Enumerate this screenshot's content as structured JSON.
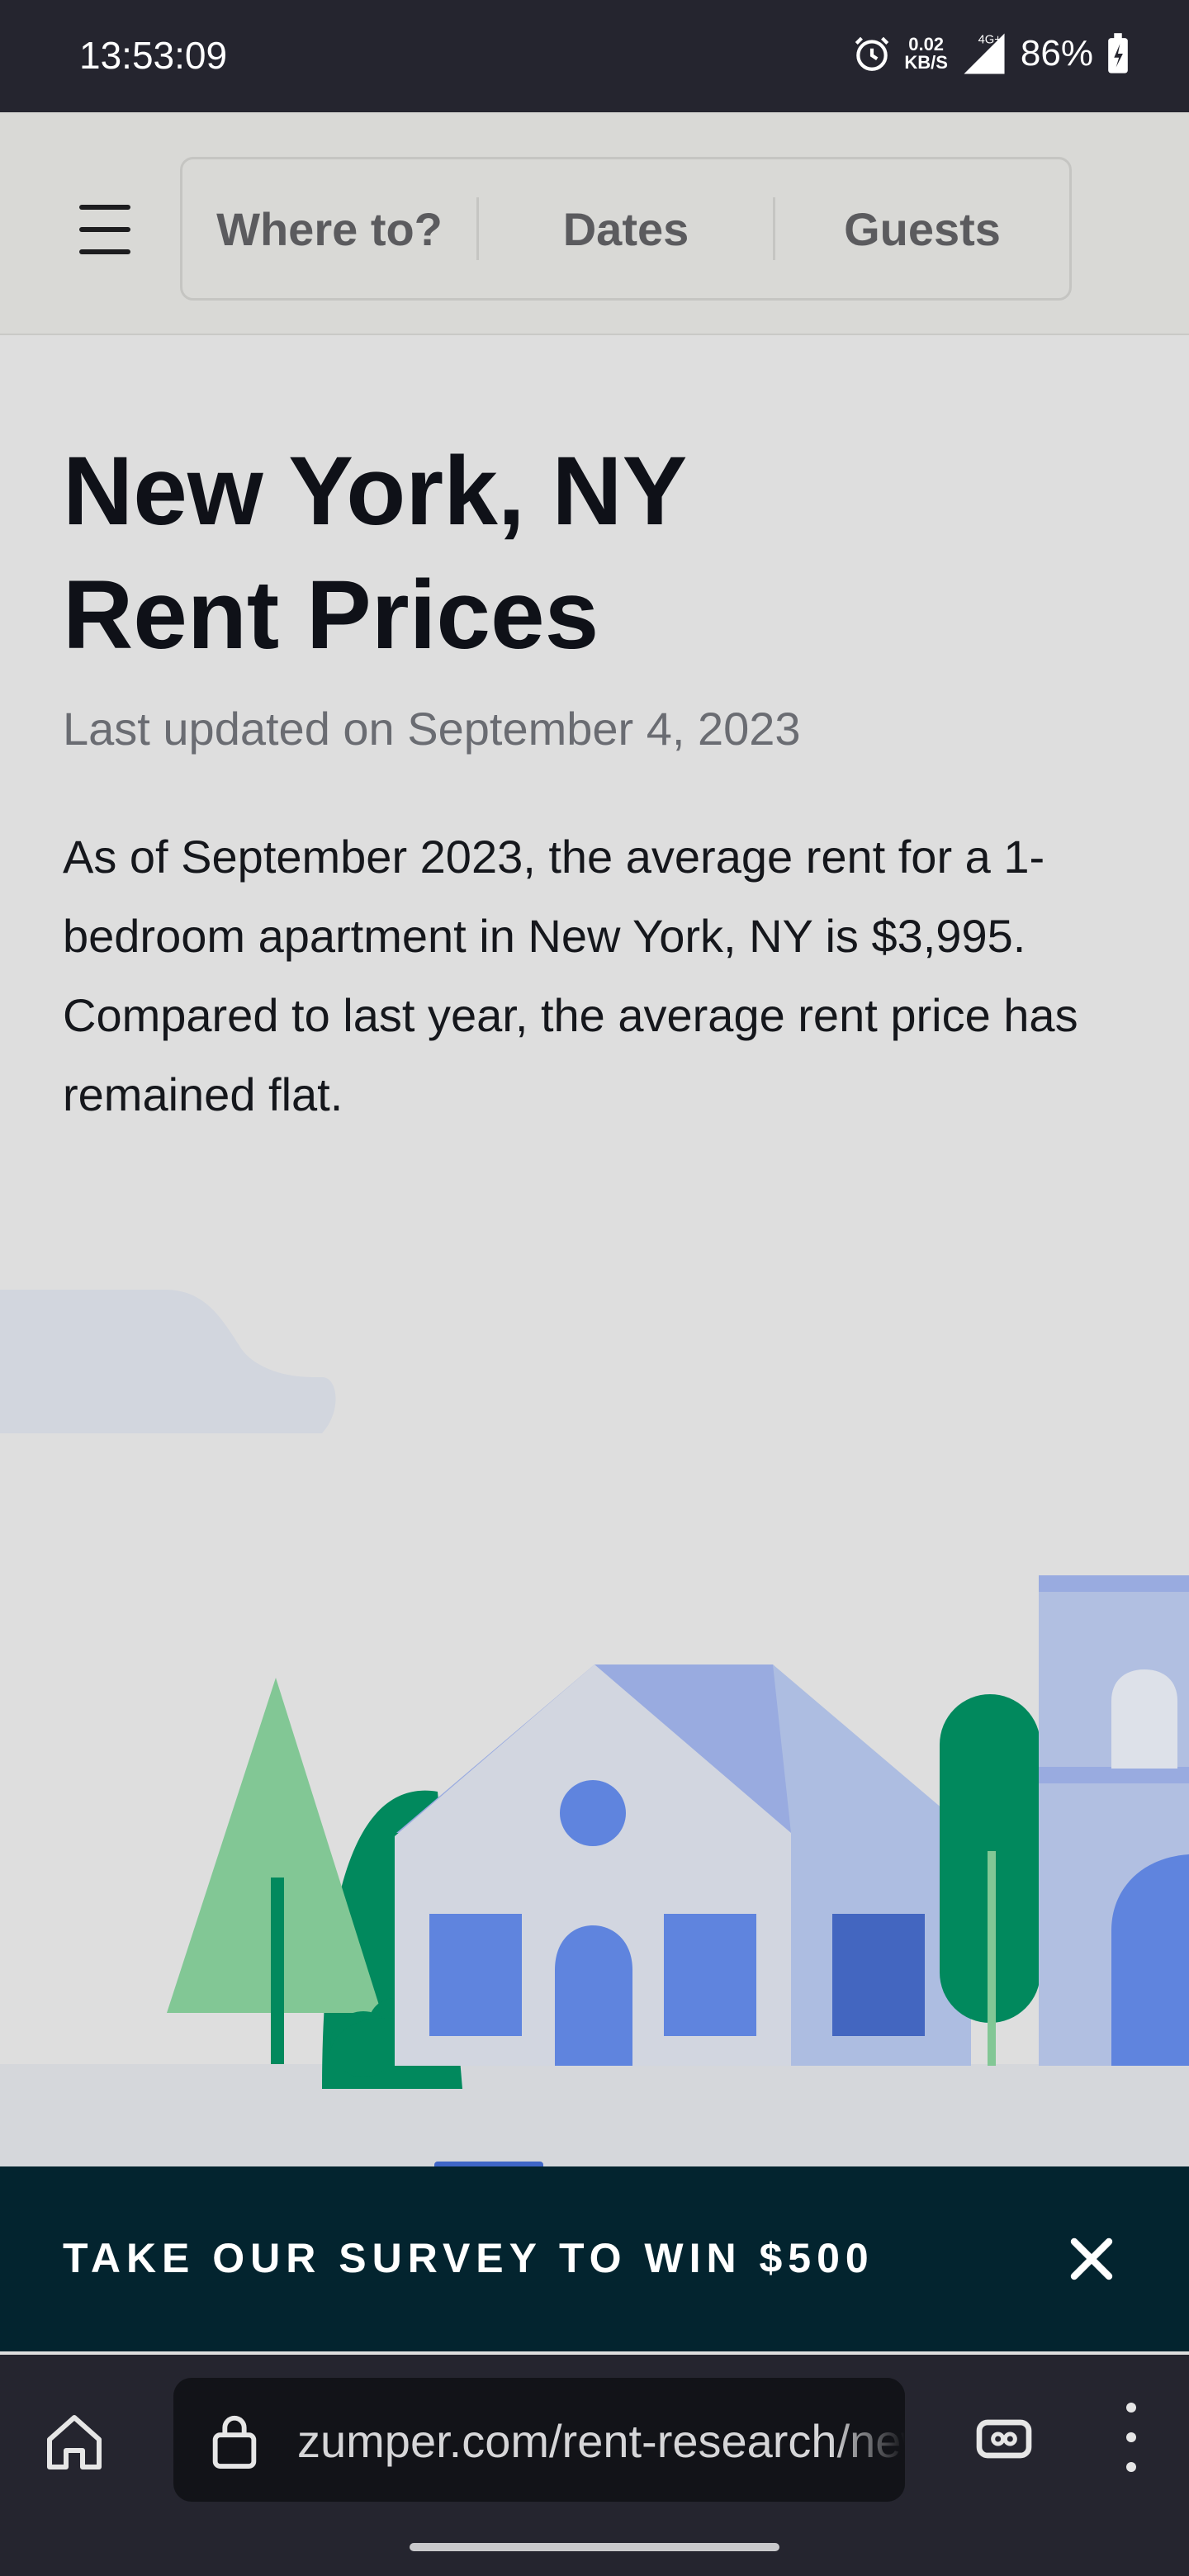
{
  "status_bar": {
    "time": "13:53:09",
    "net_speed_value": "0.02",
    "net_speed_unit": "KB/S",
    "network": "4G+",
    "battery": "86%"
  },
  "header": {
    "where_label": "Where to?",
    "dates_label": "Dates",
    "guests_label": "Guests"
  },
  "page": {
    "title_line1": "New York, NY",
    "title_line2": "Rent Prices",
    "updated": "Last updated on September 4, 2023",
    "body": "As of September 2023, the average rent for a 1-bedroom apartment in New York, NY is $3,995. Compared to last year, the average rent price has remained flat."
  },
  "banner": {
    "text": "TAKE OUR SURVEY TO WIN $500",
    "close_icon": "close-icon"
  },
  "browser": {
    "url": "zumper.com/rent-research/new-york-ny",
    "home_icon": "home-icon",
    "lock_icon": "lock-icon",
    "tabs_icon": "tabs-icon",
    "menu_icon": "more-vert-icon"
  },
  "colors": {
    "banner_bg": "#03242f",
    "accent_blue": "#5f84de",
    "tree_green": "#01895d"
  }
}
